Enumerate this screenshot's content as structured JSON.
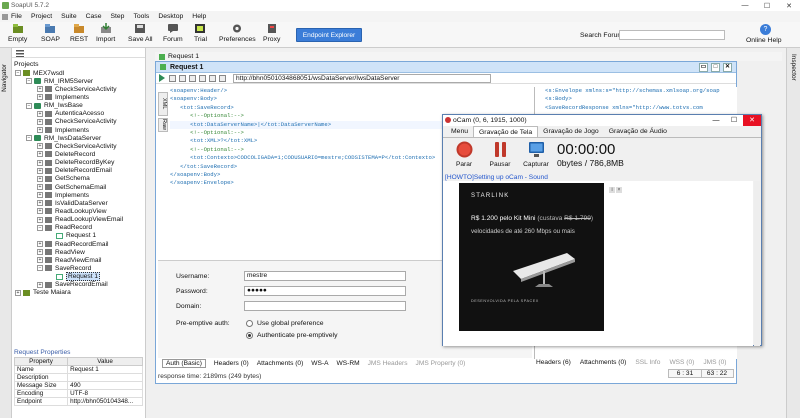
{
  "app": {
    "title": "SoapUI 5.7.2"
  },
  "menu": [
    "File",
    "Project",
    "Suite",
    "Case",
    "Step",
    "Tools",
    "Desktop",
    "Help"
  ],
  "toolbar": {
    "buttons": [
      "Empty",
      "SOAP",
      "REST",
      "Import",
      "Save All",
      "Forum",
      "Trial",
      "Preferences",
      "Proxy"
    ],
    "endpoint_explorer": "Endpoint Explorer",
    "search_label": "Search Forum",
    "search_value": "",
    "online_help": "Online Help"
  },
  "side": {
    "navigator": "Navigator",
    "inspector": "Inspector"
  },
  "navigator": {
    "title": "Projects",
    "tree": [
      {
        "label": "MEX7wsdl",
        "level": 0,
        "type": "proj",
        "exp": "-"
      },
      {
        "label": "RM_IRM5Server",
        "level": 1,
        "type": "iface",
        "exp": "-"
      },
      {
        "label": "CheckServiceActivity",
        "level": 2,
        "type": "op",
        "exp": "+"
      },
      {
        "label": "Implements",
        "level": 2,
        "type": "op",
        "exp": "+"
      },
      {
        "label": "RM_IwsBase",
        "level": 1,
        "type": "iface",
        "exp": "-"
      },
      {
        "label": "AutenticaAcesso",
        "level": 2,
        "type": "op",
        "exp": "+"
      },
      {
        "label": "CheckServiceActivity",
        "level": 2,
        "type": "op",
        "exp": "+"
      },
      {
        "label": "Implements",
        "level": 2,
        "type": "op",
        "exp": "+"
      },
      {
        "label": "RM_IwsDataServer",
        "level": 1,
        "type": "iface",
        "exp": "-"
      },
      {
        "label": "CheckServiceActivity",
        "level": 2,
        "type": "op",
        "exp": "+"
      },
      {
        "label": "DeleteRecord",
        "level": 2,
        "type": "op",
        "exp": "+"
      },
      {
        "label": "DeleteRecordByKey",
        "level": 2,
        "type": "op",
        "exp": "+"
      },
      {
        "label": "DeleteRecordEmail",
        "level": 2,
        "type": "op",
        "exp": "+"
      },
      {
        "label": "GetSchema",
        "level": 2,
        "type": "op",
        "exp": "+"
      },
      {
        "label": "GetSchemaEmail",
        "level": 2,
        "type": "op",
        "exp": "+"
      },
      {
        "label": "Implements",
        "level": 2,
        "type": "op",
        "exp": "+"
      },
      {
        "label": "IsValidDataServer",
        "level": 2,
        "type": "op",
        "exp": "+"
      },
      {
        "label": "ReadLookupView",
        "level": 2,
        "type": "op",
        "exp": "+"
      },
      {
        "label": "ReadLookupViewEmail",
        "level": 2,
        "type": "op",
        "exp": "+"
      },
      {
        "label": "ReadRecord",
        "level": 2,
        "type": "op",
        "exp": "-"
      },
      {
        "label": "Request 1",
        "level": 3,
        "type": "req",
        "exp": ""
      },
      {
        "label": "ReadRecordEmail",
        "level": 2,
        "type": "op",
        "exp": "+"
      },
      {
        "label": "ReadView",
        "level": 2,
        "type": "op",
        "exp": "+"
      },
      {
        "label": "ReadViewEmail",
        "level": 2,
        "type": "op",
        "exp": "+"
      },
      {
        "label": "SaveRecord",
        "level": 2,
        "type": "op",
        "exp": "-"
      },
      {
        "label": "Request 1",
        "level": 3,
        "type": "req",
        "exp": "",
        "selected": true
      },
      {
        "label": "SaveRecordEmail",
        "level": 2,
        "type": "op",
        "exp": "+"
      },
      {
        "label": "Teste Maiara",
        "level": 0,
        "type": "proj",
        "exp": "+"
      }
    ]
  },
  "request_properties": {
    "title": "Request Properties",
    "headers": [
      "Property",
      "Value"
    ],
    "rows": [
      [
        "Name",
        "Request 1"
      ],
      [
        "Description",
        ""
      ],
      [
        "Message Size",
        "490"
      ],
      [
        "Encoding",
        "UTF-8"
      ],
      [
        "Endpoint",
        "http://bhn050104348..."
      ]
    ]
  },
  "desktop": {
    "tab_label": "Request 1"
  },
  "request": {
    "title": "Request 1",
    "url": "http://bhn0501034868051/wsDataServer/IwsDataServer",
    "xml_tab": "XML",
    "raw_tab": "Raw",
    "xml_lines": [
      "<soapenv:Header/>",
      "<soapenv:Body>",
      "   <tot:SaveRecord>",
      "      <!--Optional:-->",
      "      <tot:DataServerName>|</tot:DataServerName>",
      "      <!--Optional:-->",
      "      <tot:XML>?</tot:XML>",
      "      <!--Optional:-->",
      "      <tot:Contexto>CODCOLIGADA=1;CODUSUARIO=mestre;CODSISTEMA=P</tot:Contexto>",
      "   </tot:SaveRecord>",
      "</soapenv:Body>",
      "</soapenv:Envelope>"
    ],
    "auth": {
      "username_label": "Username:",
      "username": "mestre",
      "password_label": "Password:",
      "password_mask": "●●●●●",
      "domain_label": "Domain:",
      "domain": "",
      "preemptive_label": "Pre-emptive auth:",
      "option_global": "Use global preference",
      "option_preemptive": "Authenticate pre-emptively"
    },
    "tabs": [
      "Auth (Basic)",
      "Headers (0)",
      "Attachments (0)",
      "WS-A",
      "WS-RM",
      "JMS Headers",
      "JMS Property (0)"
    ],
    "status": "response time: 2189ms (249 bytes)",
    "response_lines": [
      "<s:Envelope xmlns:s=\"http://schemas.xmlsoap.org/soap",
      "   <s:Body>",
      "      <SaveRecordResponse xmlns=\"http://www.totvs.com"
    ],
    "response_tabs": [
      "Headers (6)",
      "Attachments (0)",
      "SSL Info",
      "WSS (0)",
      "JMS (0)"
    ],
    "position": "63 : 22",
    "req_position": "6 : 31"
  },
  "ocam": {
    "title": "oCam (0, 6, 1915, 1000)",
    "tabs": [
      "Menu",
      "Gravação de Tela",
      "Gravação de Jogo",
      "Gravação de Áudio"
    ],
    "buttons": [
      "Parar",
      "Pausar",
      "Capturar"
    ],
    "timer": "00:00:00",
    "size": "0bytes / 786,8MB",
    "link": "[HOWTO]Setting up oCam - Sound",
    "ad": {
      "brand": "STARLINK",
      "price_prefix": "R$ 1.200 pelo Kit Mini",
      "price_old_text": "(custava",
      "price_old": "R$ 1.799",
      "price_close": ")",
      "speed": "velocidades de até 260 Mbps ou mais",
      "footer": "DESENVOLVIDA PELA  SPACEX"
    }
  }
}
